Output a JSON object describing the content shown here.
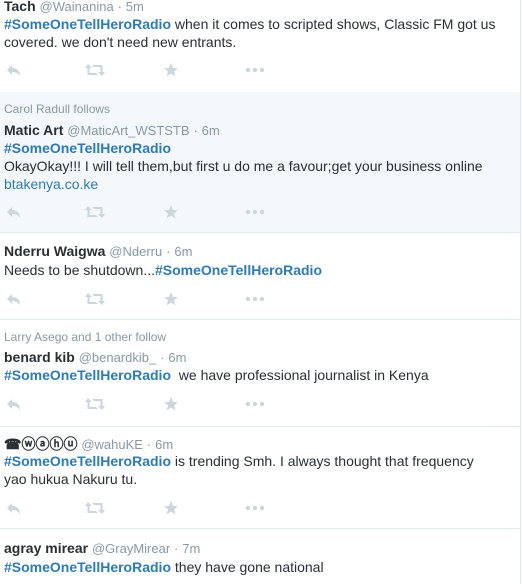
{
  "tweets": [
    {
      "name": "Tach",
      "handle": "@Wainanina",
      "sep": "·",
      "time": "5m",
      "hashtag": "#SomeOneTellHeroRadio",
      "text_line1": " when it comes to scripted shows, Classic FM got us",
      "text_line2": "covered. we don't need new entrants."
    },
    {
      "context": "Carol Radull follows",
      "name": "Matic Art",
      "handle": "@MaticArt_WSTSTB",
      "sep": "·",
      "time": "6m",
      "hashtag": "#SomeOneTellHeroRadio",
      "text_line2": "OkayOkay!!! I will tell them,but first u do me a favour;get your business online",
      "link": "btakenya.co.ke"
    },
    {
      "name": "Nderru Waigwa",
      "handle": "@Nderru",
      "sep": "·",
      "time": "6m",
      "text_prefix": "Needs to be shutdown...",
      "hashtag": "#SomeOneTellHeroRadio"
    },
    {
      "context": "Larry Asego and 1 other follow",
      "name": "benard kib",
      "handle": "@benardkib_",
      "sep": "·",
      "time": "6m",
      "hashtag": "#SomeOneTellHeroRadio",
      "text_line1": "  we have professional journalist in Kenya"
    },
    {
      "name": "☎ⓦⓐⓗⓤ",
      "handle": "@wahuKE",
      "sep": "·",
      "time": "6m",
      "hashtag": "#SomeOneTellHeroRadio",
      "text_line1": " is trending Smh. I always thought that frequency",
      "text_line2": "yao hukua Nakuru tu."
    },
    {
      "name": "agray mirear",
      "handle": "@GrayMirear",
      "sep": "·",
      "time": "7m",
      "hashtag": "#SomeOneTellHeroRadio",
      "text_line1": " they have gone national"
    }
  ],
  "icons": [
    "reply-icon",
    "retweet-icon",
    "favorite-icon",
    "more-icon"
  ],
  "colors": {
    "hashtag": "#2b7bb9",
    "meta": "#8899a6",
    "icon": "#ccd6dd",
    "highlight_bg": "#f5f8fa"
  }
}
